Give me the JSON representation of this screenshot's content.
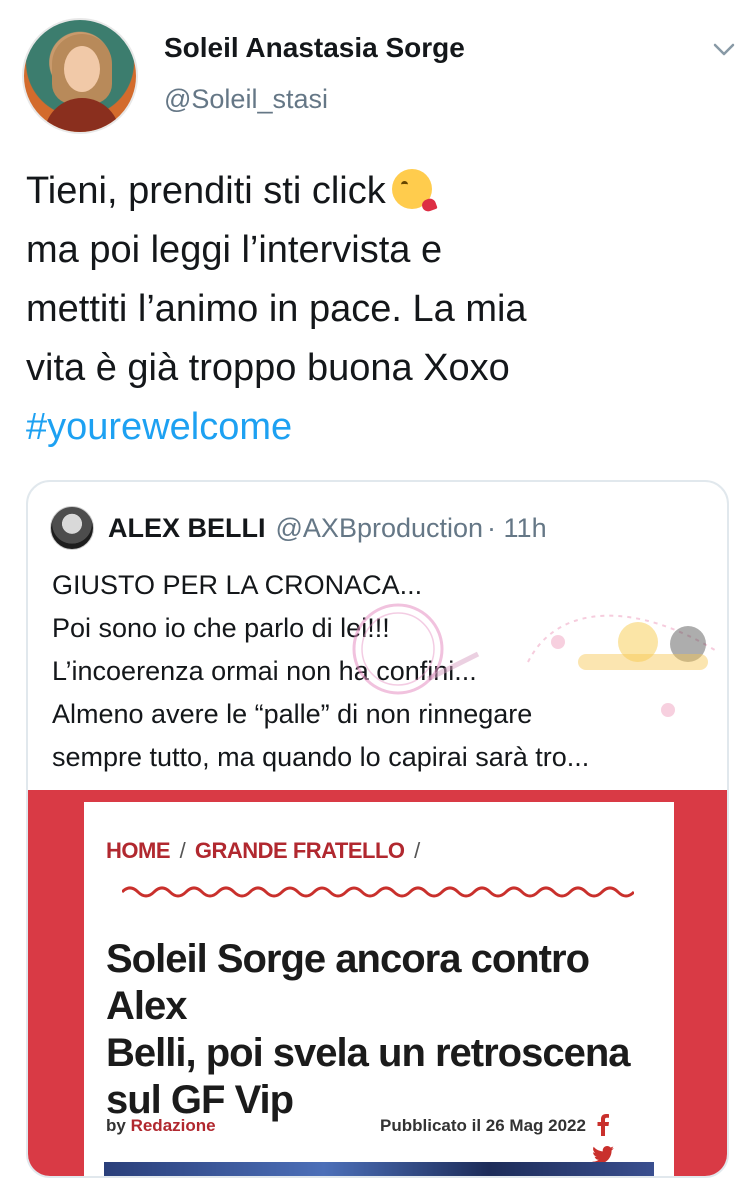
{
  "author": {
    "name": "Soleil Anastasia Sorge",
    "handle": "@Soleil_stasi"
  },
  "tweet": {
    "lines": [
      "Tieni, prenditi sti click",
      "ma poi leggi l’intervista e",
      "mettiti l’animo in pace. La mia",
      "vita è già troppo buona Xoxo"
    ],
    "hashtag": "#yourewelcome",
    "emoji": "kissing-face-heart-icon"
  },
  "quoted": {
    "name": "ALEX BELLI",
    "handle": "@AXBproduction",
    "time": "· 11h",
    "lines": [
      "GIUSTO PER LA CRONACA...",
      "Poi sono io che parlo di lei!!!",
      "L’incoerenza ormai non ha confini...",
      "Almeno avere le “palle” di non rinnegare",
      "sempre tutto, ma quando lo capirai sarà tro..."
    ],
    "article": {
      "breadcrumb_home": "HOME",
      "breadcrumb_section": "GRANDE FRATELLO",
      "sep": "/",
      "headline_lines": [
        "Soleil Sorge ancora contro Alex",
        "Belli, poi svela un retroscena",
        "sul GF Vip"
      ],
      "by_prefix": "by",
      "by_author": "Redazione",
      "published": "Pubblicato il 26 Mag 2022"
    }
  },
  "colors": {
    "hashtag": "#1da1f2",
    "secondary_text": "#657786",
    "article_red": "#d93a45",
    "breadcrumb_red": "#b1282f"
  }
}
